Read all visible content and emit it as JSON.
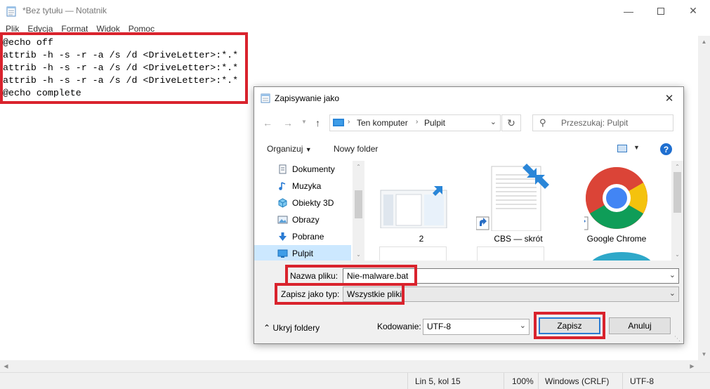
{
  "notepad": {
    "title": "*Bez tytułu — Notatnik",
    "menu": [
      "Plik",
      "Edycja",
      "Format",
      "Widok",
      "Pomoc"
    ],
    "lines": [
      "@echo off",
      "attrib -h -s -r -a /s /d <DriveLetter>:*.*",
      "attrib -h -s -r -a /s /d <DriveLetter>:*.*",
      "attrib -h -s -r -a /s /d <DriveLetter>:*.*",
      "@echo complete"
    ],
    "status": {
      "position": "Lin 5, kol 15",
      "zoom": "100%",
      "line_endings": "Windows (CRLF)",
      "encoding": "UTF-8"
    }
  },
  "dialog": {
    "title": "Zapisywanie jako",
    "address": [
      "Ten komputer",
      "Pulpit"
    ],
    "search_placeholder": "Przeszukaj: Pulpit",
    "organize_label": "Organizuj",
    "new_folder_label": "Nowy folder",
    "nav_items": [
      "Dokumenty",
      "Muzyka",
      "Obiekty 3D",
      "Obrazy",
      "Pobrane",
      "Pulpit"
    ],
    "selected_nav": "Pulpit",
    "files": [
      "2",
      "CBS — skrót",
      "Google Chrome"
    ],
    "filename_label": "Nazwa pliku:",
    "filename_value": "Nie-malware.bat",
    "filetype_label": "Zapisz jako typ:",
    "filetype_value": "Wszystkie pliki",
    "encoding_label": "Kodowanie:",
    "encoding_value": "UTF-8",
    "save_label": "Zapisz",
    "cancel_label": "Anuluj",
    "hide_folders_label": "Ukryj foldery"
  },
  "colors": {
    "highlight_red": "#d9232d",
    "selection_blue": "#cce8ff",
    "accent_blue": "#2a7bd3"
  }
}
